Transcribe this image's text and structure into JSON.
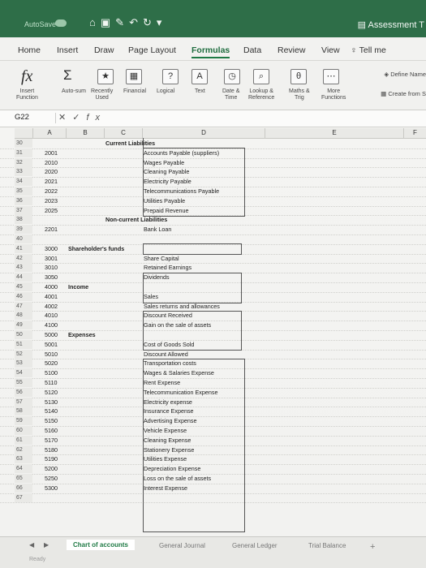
{
  "window": {
    "autosave_label": "AutoSave",
    "title": "Assessment T"
  },
  "menu": [
    "Home",
    "Insert",
    "Draw",
    "Page Layout",
    "Formulas",
    "Data",
    "Review",
    "View",
    "Tell me"
  ],
  "menu_active": "Formulas",
  "ribbon": {
    "insert_function": "Insert\nFunction",
    "autosum": "Auto-sum",
    "recently_used": "Recently\nUsed",
    "financial": "Financial",
    "logical": "Logical",
    "text": "Text",
    "date_time": "Date &\nTime",
    "lookup_reference": "Lookup &\nReference",
    "maths_trig": "Maths &\nTrig",
    "more_functions": "More\nFunctions",
    "define_name": "Define Name",
    "create_from": "Create from S"
  },
  "formula_bar": {
    "name_box": "G22",
    "fx": "fx",
    "value": ""
  },
  "columns": [
    "A",
    "B",
    "C",
    "D",
    "E",
    "F"
  ],
  "rows": [
    {
      "n": "30",
      "a": "",
      "b": "",
      "c": "Current Liabilities",
      "d": ""
    },
    {
      "n": "31",
      "a": "2001",
      "b": "",
      "c": "",
      "d": "Accounts Payable (suppliers)"
    },
    {
      "n": "32",
      "a": "2010",
      "b": "",
      "c": "",
      "d": "Wages Payable"
    },
    {
      "n": "33",
      "a": "2020",
      "b": "",
      "c": "",
      "d": "Cleaning Payable"
    },
    {
      "n": "34",
      "a": "2021",
      "b": "",
      "c": "",
      "d": "Electricity Payable"
    },
    {
      "n": "35",
      "a": "2022",
      "b": "",
      "c": "",
      "d": "Telecommunications Payable"
    },
    {
      "n": "36",
      "a": "2023",
      "b": "",
      "c": "",
      "d": "Utilities Payable"
    },
    {
      "n": "37",
      "a": "2025",
      "b": "",
      "c": "",
      "d": "Prepaid Revenue"
    },
    {
      "n": "38",
      "a": "",
      "b": "",
      "c": "Non-current Liabilities",
      "d": ""
    },
    {
      "n": "39",
      "a": "2201",
      "b": "",
      "c": "",
      "d": "Bank Loan"
    },
    {
      "n": "40",
      "a": "",
      "b": "",
      "c": "",
      "d": ""
    },
    {
      "n": "41",
      "a": "3000",
      "b": "Shareholder's funds",
      "c": "",
      "d": ""
    },
    {
      "n": "42",
      "a": "3001",
      "b": "",
      "c": "",
      "d": "Share Capital"
    },
    {
      "n": "43",
      "a": "3010",
      "b": "",
      "c": "",
      "d": "Retained Earnings"
    },
    {
      "n": "44",
      "a": "3050",
      "b": "",
      "c": "",
      "d": "Dividends"
    },
    {
      "n": "45",
      "a": "4000",
      "b": "Income",
      "c": "",
      "d": ""
    },
    {
      "n": "46",
      "a": "4001",
      "b": "",
      "c": "",
      "d": "Sales"
    },
    {
      "n": "47",
      "a": "4002",
      "b": "",
      "c": "",
      "d": "Sales returns and allowances"
    },
    {
      "n": "48",
      "a": "4010",
      "b": "",
      "c": "",
      "d": "Discount Received"
    },
    {
      "n": "49",
      "a": "4100",
      "b": "",
      "c": "",
      "d": "Gain on the sale of assets"
    },
    {
      "n": "50",
      "a": "5000",
      "b": "Expenses",
      "c": "",
      "d": ""
    },
    {
      "n": "51",
      "a": "5001",
      "b": "",
      "c": "",
      "d": "Cost of Goods Sold"
    },
    {
      "n": "52",
      "a": "5010",
      "b": "",
      "c": "",
      "d": "Discount Allowed"
    },
    {
      "n": "53",
      "a": "5020",
      "b": "",
      "c": "",
      "d": "Transportation costs"
    },
    {
      "n": "54",
      "a": "5100",
      "b": "",
      "c": "",
      "d": "Wages & Salaries Expense"
    },
    {
      "n": "55",
      "a": "5110",
      "b": "",
      "c": "",
      "d": "Rent Expense"
    },
    {
      "n": "56",
      "a": "5120",
      "b": "",
      "c": "",
      "d": "Telecommunication Expense"
    },
    {
      "n": "57",
      "a": "5130",
      "b": "",
      "c": "",
      "d": "Electricity expense"
    },
    {
      "n": "58",
      "a": "5140",
      "b": "",
      "c": "",
      "d": "Insurance Expense"
    },
    {
      "n": "59",
      "a": "5150",
      "b": "",
      "c": "",
      "d": "Advertising Expense"
    },
    {
      "n": "60",
      "a": "5160",
      "b": "",
      "c": "",
      "d": "Vehicle Expense"
    },
    {
      "n": "61",
      "a": "5170",
      "b": "",
      "c": "",
      "d": "Cleaning Expense"
    },
    {
      "n": "62",
      "a": "5180",
      "b": "",
      "c": "",
      "d": "Stationery Expense"
    },
    {
      "n": "63",
      "a": "5190",
      "b": "",
      "c": "",
      "d": "Utilities Expense"
    },
    {
      "n": "64",
      "a": "5200",
      "b": "",
      "c": "",
      "d": "Depreciation Expense"
    },
    {
      "n": "65",
      "a": "5250",
      "b": "",
      "c": "",
      "d": "Loss on the sale of assets"
    },
    {
      "n": "66",
      "a": "5300",
      "b": "",
      "c": "",
      "d": "Interest Expense"
    },
    {
      "n": "67",
      "a": "",
      "b": "",
      "c": "",
      "d": ""
    }
  ],
  "sheet_tabs": [
    "Chart of accounts",
    "General Journal",
    "General Ledger",
    "Trial Balance"
  ],
  "active_sheet": "Chart of accounts",
  "status": {
    "ready": "Ready"
  }
}
